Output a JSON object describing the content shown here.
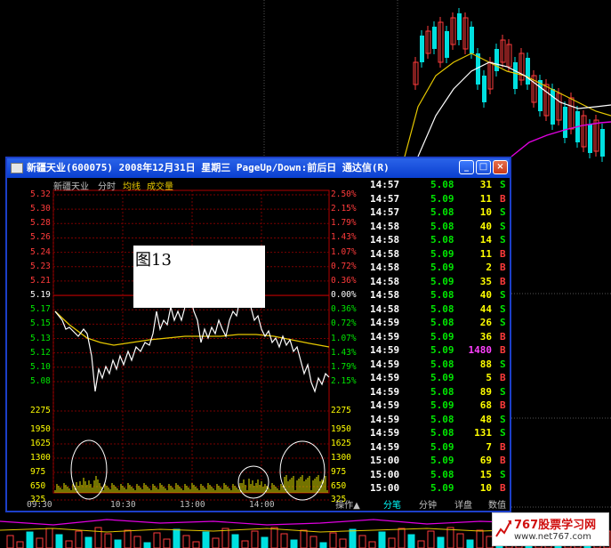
{
  "window": {
    "title": "新疆天业(600075) 2008年12月31日 星期三 PageUp/Down:前后日 通达信(R)",
    "buttons": [
      "_",
      "□",
      "×"
    ]
  },
  "chart_header": {
    "name": "新疆天业",
    "mode": "分时",
    "ma_label": "均线",
    "vol_label": "成交量"
  },
  "price_axis_left": [
    "5.32",
    "5.30",
    "5.28",
    "5.26",
    "5.24",
    "5.23",
    "5.21",
    "5.19",
    "5.17",
    "5.15",
    "5.13",
    "5.12",
    "5.10",
    "5.08"
  ],
  "pct_axis_right": [
    "2.50%",
    "2.15%",
    "1.79%",
    "1.43%",
    "1.07%",
    "0.72%",
    "0.36%",
    "0.00%",
    "0.36%",
    "0.72%",
    "1.07%",
    "1.43%",
    "1.79%",
    "2.15%"
  ],
  "volume_axis": [
    "2275",
    "1950",
    "1625",
    "1300",
    "975",
    "650",
    "325"
  ],
  "time_axis": [
    "09:30",
    "10:30",
    "13:00",
    "14:00"
  ],
  "figure_label": "图13",
  "ticks": [
    {
      "time": "14:57",
      "price": "5.08",
      "vol": "31",
      "bs": "S"
    },
    {
      "time": "14:57",
      "price": "5.09",
      "vol": "11",
      "bs": "B"
    },
    {
      "time": "14:57",
      "price": "5.08",
      "vol": "10",
      "bs": "S"
    },
    {
      "time": "14:58",
      "price": "5.08",
      "vol": "40",
      "bs": "S"
    },
    {
      "time": "14:58",
      "price": "5.08",
      "vol": "14",
      "bs": "S"
    },
    {
      "time": "14:58",
      "price": "5.09",
      "vol": "11",
      "bs": "B"
    },
    {
      "time": "14:58",
      "price": "5.09",
      "vol": "2",
      "bs": "B"
    },
    {
      "time": "14:58",
      "price": "5.09",
      "vol": "35",
      "bs": "B"
    },
    {
      "time": "14:58",
      "price": "5.08",
      "vol": "40",
      "bs": "S"
    },
    {
      "time": "14:58",
      "price": "5.08",
      "vol": "44",
      "bs": "S"
    },
    {
      "time": "14:59",
      "price": "5.08",
      "vol": "26",
      "bs": "S"
    },
    {
      "time": "14:59",
      "price": "5.09",
      "vol": "36",
      "bs": "B"
    },
    {
      "time": "14:59",
      "price": "5.09",
      "vol": "1480",
      "bs": "B"
    },
    {
      "time": "14:59",
      "price": "5.08",
      "vol": "88",
      "bs": "S"
    },
    {
      "time": "14:59",
      "price": "5.09",
      "vol": "5",
      "bs": "B"
    },
    {
      "time": "14:59",
      "price": "5.08",
      "vol": "89",
      "bs": "S"
    },
    {
      "time": "14:59",
      "price": "5.09",
      "vol": "68",
      "bs": "B"
    },
    {
      "time": "14:59",
      "price": "5.08",
      "vol": "48",
      "bs": "S"
    },
    {
      "time": "14:59",
      "price": "5.08",
      "vol": "131",
      "bs": "S"
    },
    {
      "time": "14:59",
      "price": "5.09",
      "vol": "7",
      "bs": "B"
    },
    {
      "time": "15:00",
      "price": "5.09",
      "vol": "69",
      "bs": "B"
    },
    {
      "time": "15:00",
      "price": "5.08",
      "vol": "15",
      "bs": "S"
    },
    {
      "time": "15:00",
      "price": "5.09",
      "vol": "10",
      "bs": "B"
    }
  ],
  "tabs": [
    "操作▲",
    "分笔",
    "分钟",
    "详盘",
    "数值"
  ],
  "active_tab": "分笔",
  "watermark": {
    "title": "767股票学习网",
    "url": "www.net767.com"
  },
  "colors": {
    "up": "#ff3b3b",
    "down": "#00e600",
    "price_line": "#ffffff",
    "avg_line": "#e6c800",
    "volume": "#e6e600",
    "title_bar": "#0a3fd0"
  }
}
